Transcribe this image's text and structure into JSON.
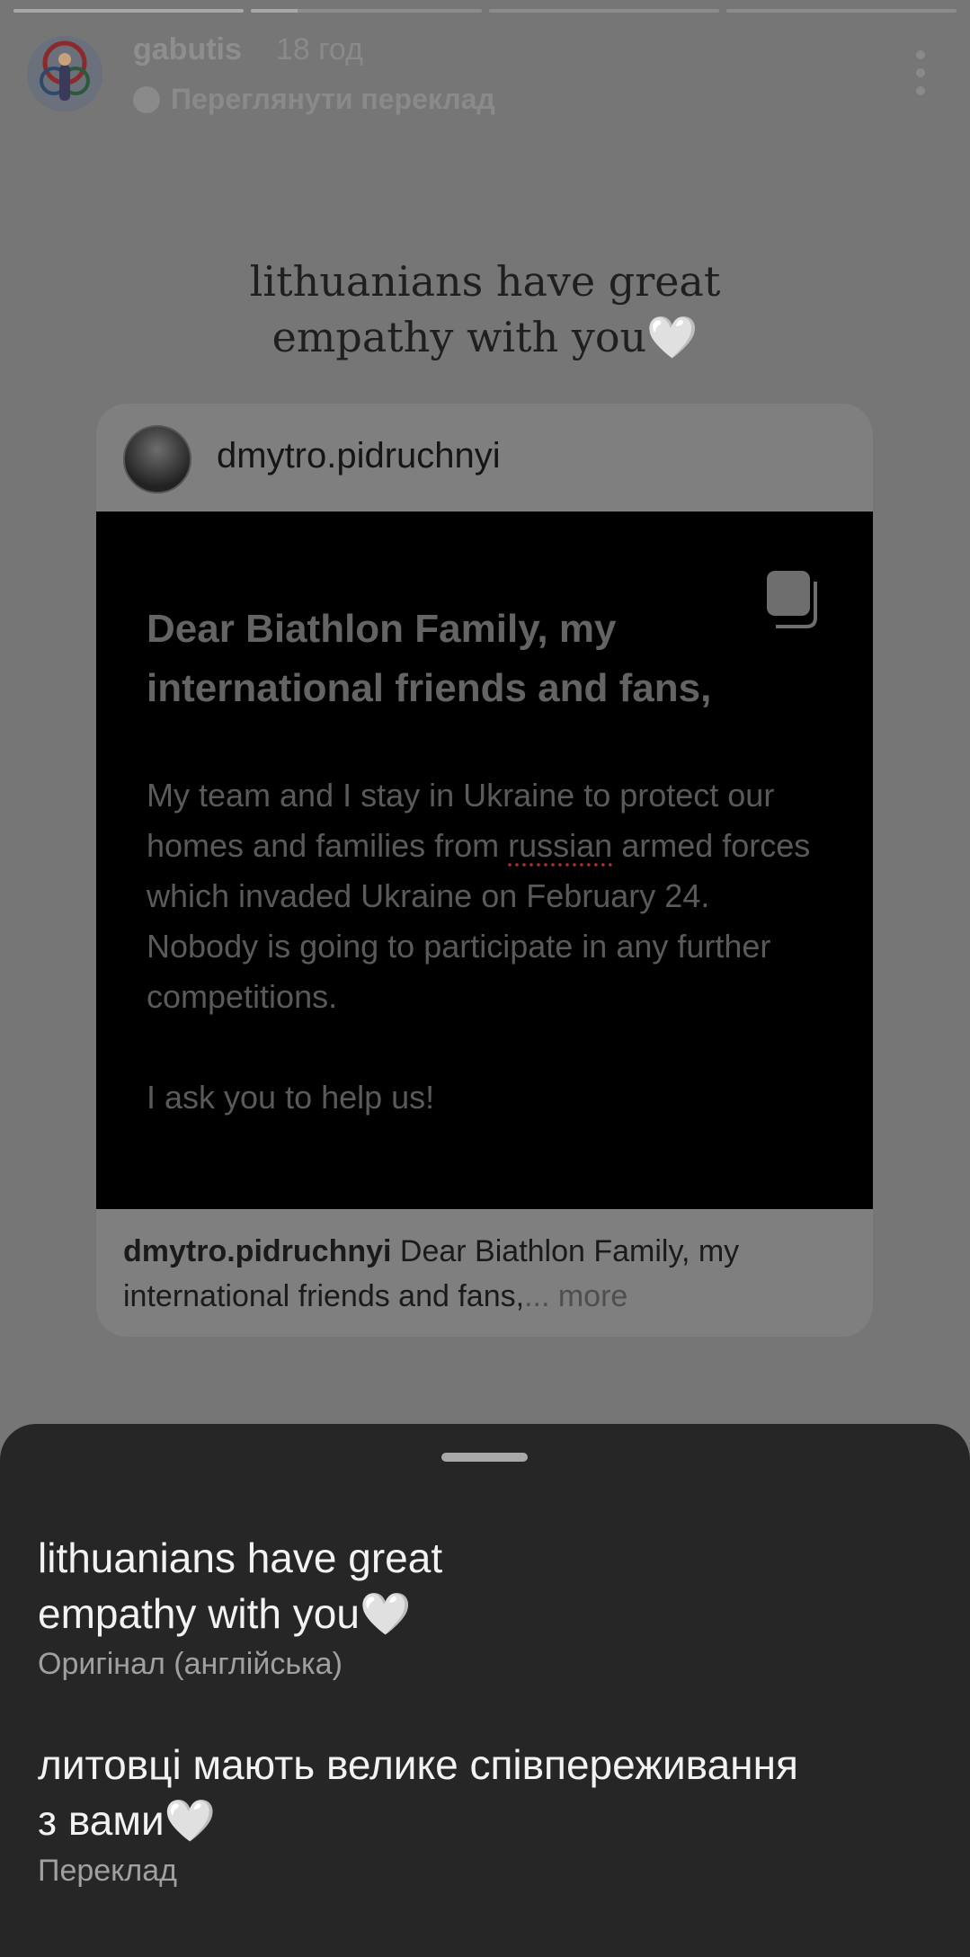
{
  "story": {
    "progress": [
      1.0,
      0.2,
      0.0,
      0.0
    ],
    "username": "gabutis",
    "time": "18 год",
    "translate_label": "Переглянути переклад",
    "caption_line1": "lithuanians have great",
    "caption_line2": "empathy with you🤍"
  },
  "shared_post": {
    "username": "dmytro.pidruchnyi",
    "heading": "Dear Biathlon Family, my international friends and fans,",
    "body_before": "My team and I stay in Ukraine to protect our homes and families from ",
    "body_underlined": "russian",
    "body_after": " armed forces which invaded Ukraine on February 24. Nobody is going to participate in any further competitions.",
    "body_plea": "I ask you to help us!",
    "caption_user": "dmytro.pidruchnyi",
    "caption_text": " Dear Biathlon Family, my international friends and fans,",
    "caption_more": "... more"
  },
  "sheet": {
    "original_line1": "lithuanians have great",
    "original_line2": "empathy with you🤍",
    "original_label": "Оригінал (англійська)",
    "translation_line1": "литовці мають велике співпереживання",
    "translation_line2": "з вами🤍",
    "translation_label": "Переклад"
  }
}
